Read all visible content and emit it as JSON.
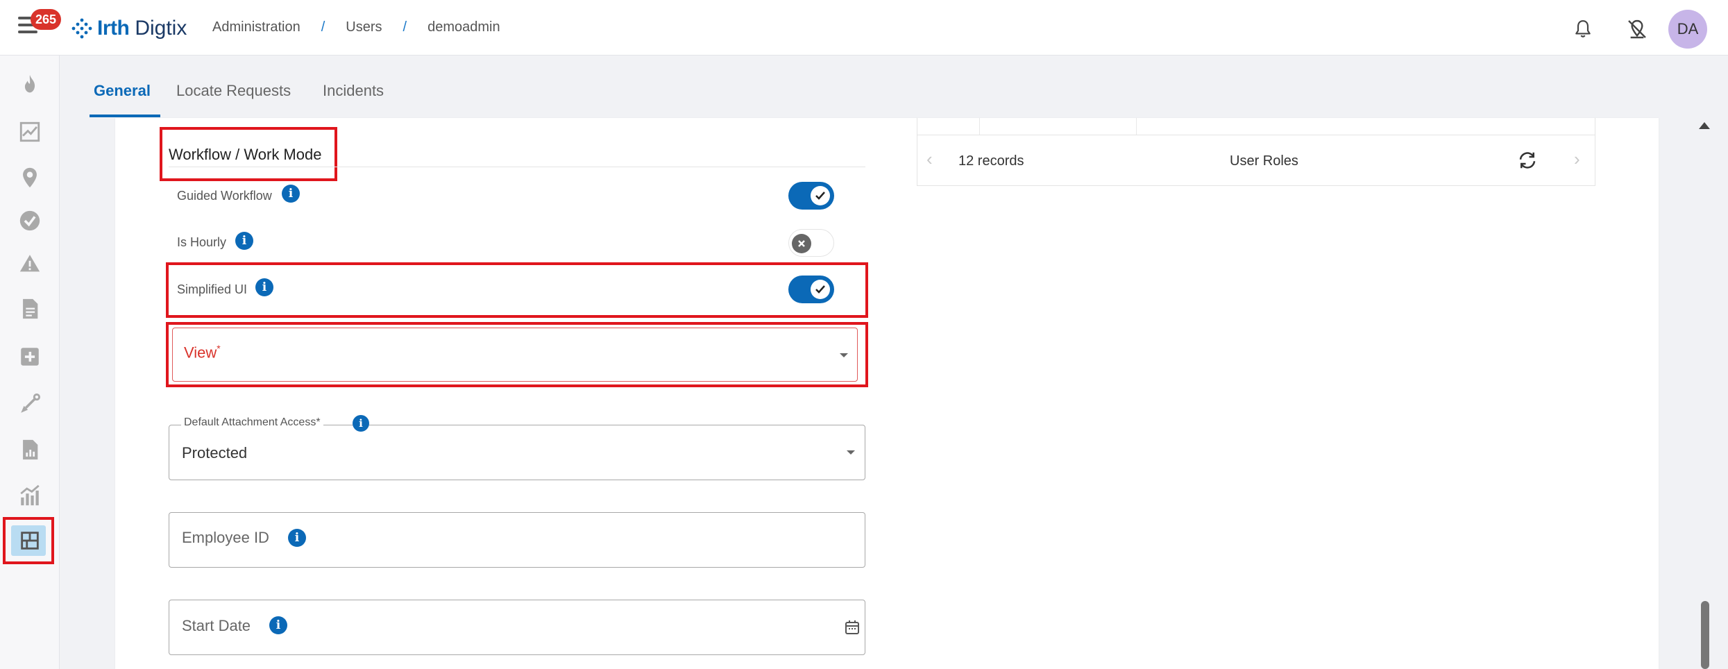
{
  "header": {
    "notification_count": "265",
    "logo_primary": "Irth",
    "logo_secondary": "Digtix",
    "breadcrumb": [
      "Administration",
      "Users",
      "demoadmin"
    ],
    "breadcrumb_separator": "/",
    "avatar_initials": "DA"
  },
  "sidebar": {
    "items": [
      {
        "icon": "flame-icon"
      },
      {
        "icon": "trending-chart-icon"
      },
      {
        "icon": "location-pin-icon"
      },
      {
        "icon": "check-circle-icon"
      },
      {
        "icon": "warning-icon"
      },
      {
        "icon": "document-icon"
      },
      {
        "icon": "add-box-icon"
      },
      {
        "icon": "shovel-icon"
      },
      {
        "icon": "report-icon"
      },
      {
        "icon": "analytics-icon"
      },
      {
        "icon": "sparkle-icon"
      },
      {
        "icon": "admin-layout-icon",
        "active": true
      }
    ]
  },
  "tabs": [
    {
      "label": "General",
      "active": true
    },
    {
      "label": "Locate Requests",
      "active": false
    },
    {
      "label": "Incidents",
      "active": false
    }
  ],
  "form": {
    "section_title": "Workflow / Work Mode",
    "guided_workflow": {
      "label": "Guided Workflow",
      "on": true
    },
    "is_hourly": {
      "label": "Is Hourly",
      "on": false
    },
    "simplified_ui": {
      "label": "Simplified UI",
      "on": true
    },
    "view": {
      "label": "View",
      "required_marker": "*",
      "value": ""
    },
    "default_attachment_access": {
      "label": "Default Attachment Access",
      "required_marker": "*",
      "value": "Protected"
    },
    "employee_id": {
      "label": "Employee ID",
      "value": ""
    },
    "start_date": {
      "label": "Start Date",
      "value": ""
    }
  },
  "user_roles_table": {
    "records": "12 records",
    "title": "User Roles"
  },
  "colors": {
    "primary": "#0b69b7",
    "highlight": "#e0161d",
    "error": "#d9332b"
  }
}
